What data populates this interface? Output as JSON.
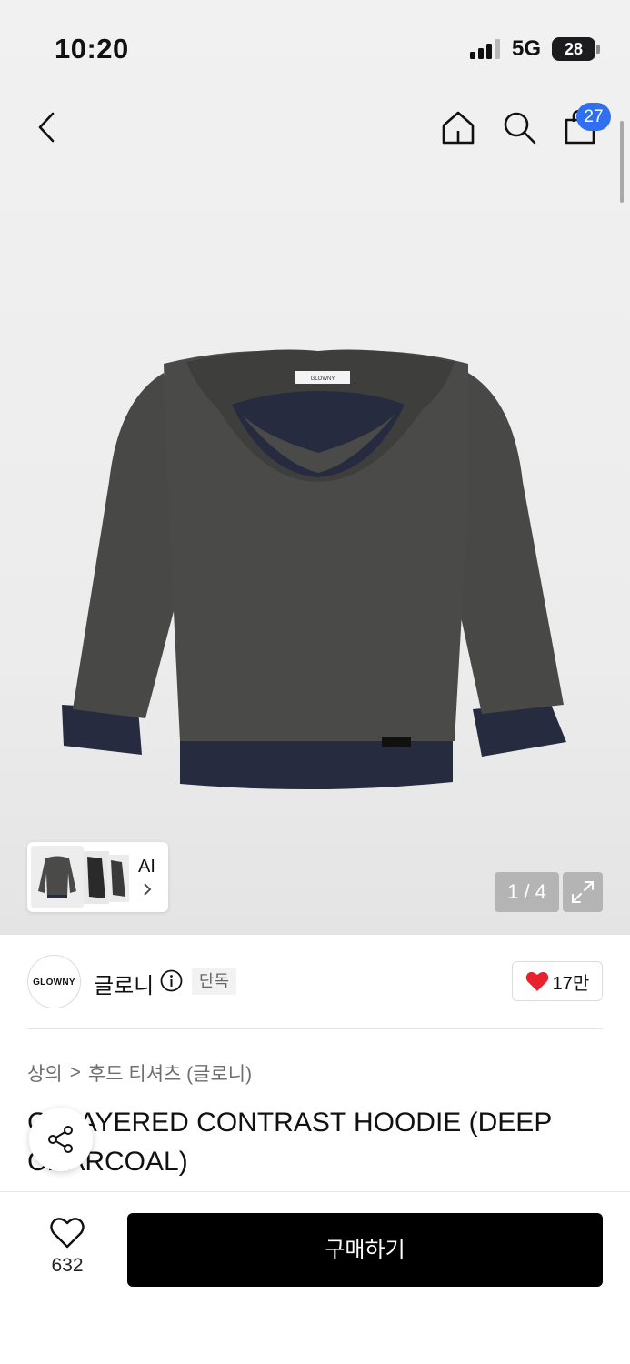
{
  "status_bar": {
    "time": "10:20",
    "network": "5G",
    "battery": "28"
  },
  "nav": {
    "cart_count": "27",
    "icons": [
      "chevron-left-icon",
      "home-icon",
      "search-icon",
      "shopping-bag-icon"
    ]
  },
  "gallery": {
    "counter": "1 / 4",
    "ai_label": "AI",
    "garment_label": "GLOWNY",
    "colors": {
      "body": "#4a4b48",
      "layer": "#262b3f"
    }
  },
  "brand": {
    "logo_text": "GLOWNY",
    "name": "글로니",
    "tag": "단독",
    "likes": "17만"
  },
  "breadcrumb": {
    "level1": "상의",
    "separator": ">",
    "level2": "후드 티셔츠 (글로니)"
  },
  "product": {
    "title": "G. LAYERED CONTRAST HOODIE (DEEP CHARCOAL)"
  },
  "bottom": {
    "wishlist_count": "632",
    "buy_label": "구매하기"
  },
  "colors": {
    "accent": "#2f6ff0",
    "heart": "#e8222c",
    "buy_bg": "#000000"
  }
}
